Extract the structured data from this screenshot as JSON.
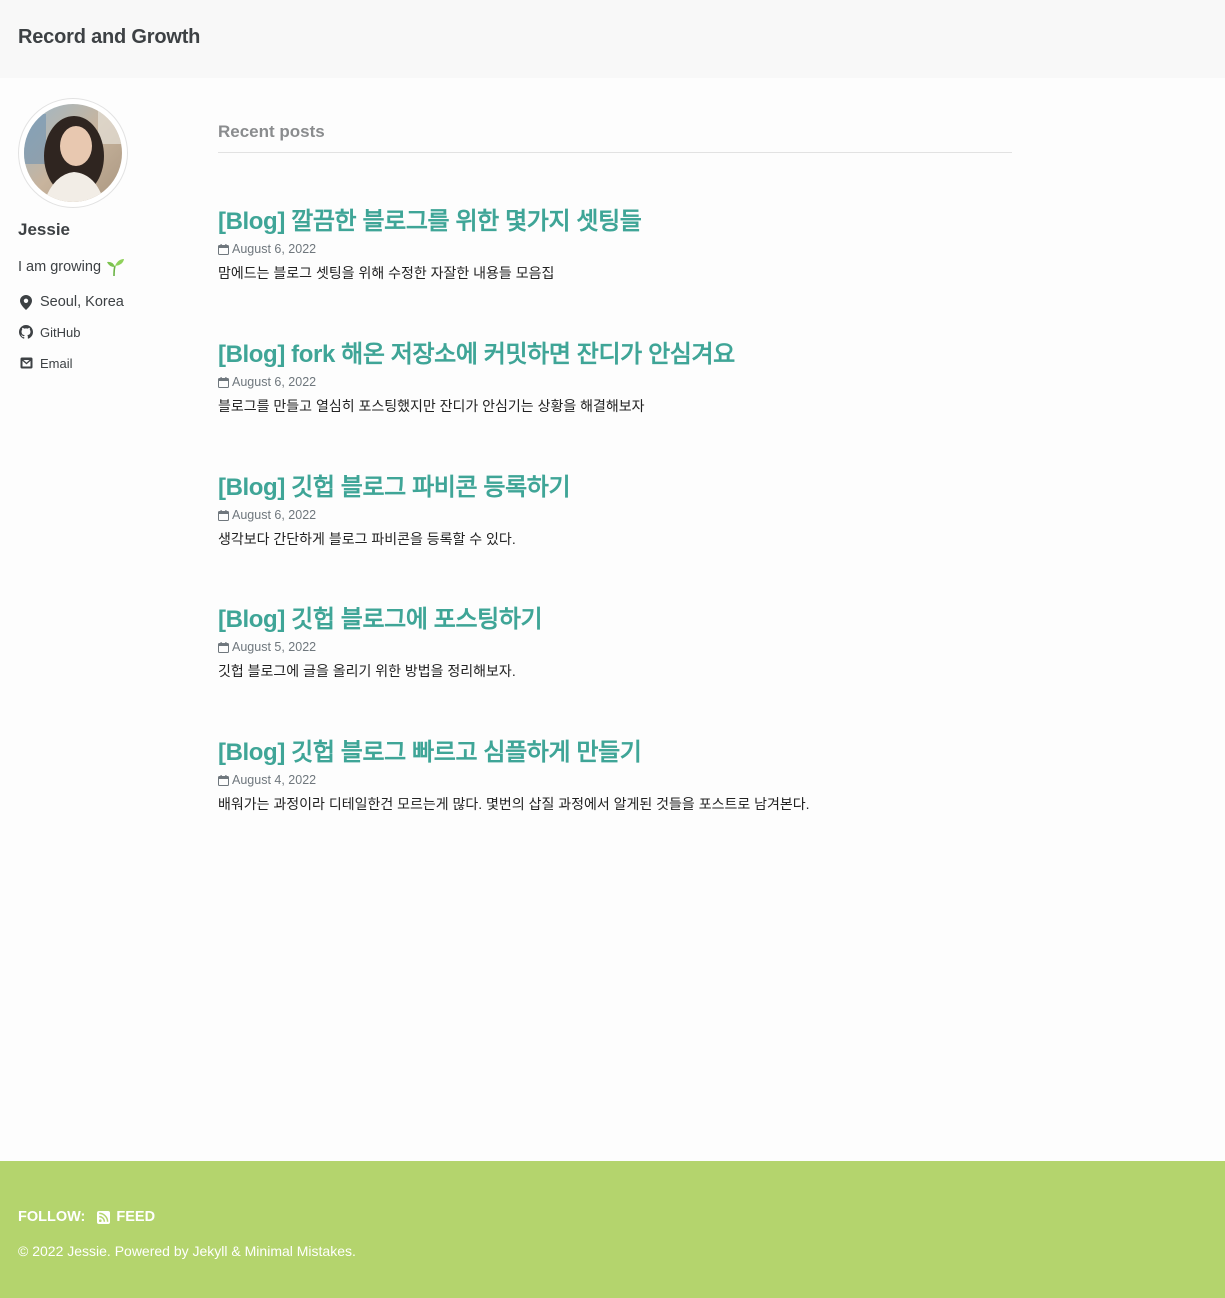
{
  "site": {
    "title": "Record and Growth"
  },
  "author": {
    "name": "Jessie",
    "bio": "I am growing",
    "location": "Seoul, Korea",
    "github_label": "GitHub",
    "email_label": "Email"
  },
  "main": {
    "section_title": "Recent posts",
    "posts": [
      {
        "title": "[Blog] 깔끔한 블로그를 위한 몇가지 셋팅들",
        "date": "August 6, 2022",
        "excerpt": "맘에드는 블로그 셋팅을 위해 수정한 자잘한 내용들 모음집"
      },
      {
        "title": "[Blog] fork 해온 저장소에 커밋하면 잔디가 안심겨요",
        "date": "August 6, 2022",
        "excerpt": "블로그를 만들고 열심히 포스팅했지만 잔디가 안심기는 상황을 해결해보자"
      },
      {
        "title": "[Blog] 깃헙 블로그 파비콘 등록하기",
        "date": "August 6, 2022",
        "excerpt": "생각보다 간단하게 블로그 파비콘을 등록할 수 있다."
      },
      {
        "title": "[Blog] 깃헙 블로그에 포스팅하기",
        "date": "August 5, 2022",
        "excerpt": "깃헙 블로그에 글을 올리기 위한 방법을 정리해보자."
      },
      {
        "title": "[Blog] 깃헙 블로그 빠르고 심플하게 만들기",
        "date": "August 4, 2022",
        "excerpt": "배워가는 과정이라 디테일한건 모르는게 많다. 몇번의 삽질 과정에서 알게된 것들을 포스트로 남겨본다."
      }
    ]
  },
  "footer": {
    "follow_label": "FOLLOW:",
    "feed_label": "FEED",
    "copyright": "© 2022 Jessie. Powered by Jekyll & Minimal Mistakes."
  },
  "icons": {
    "location": "map-marker-icon",
    "github": "github-icon",
    "email": "envelope-icon",
    "date": "calendar-icon",
    "feed": "rss-icon",
    "bio": "sprout-icon"
  },
  "colors": {
    "accent": "#3fa597",
    "footer_bg": "#b4d46d",
    "masthead_bg": "#f8f8f8"
  }
}
